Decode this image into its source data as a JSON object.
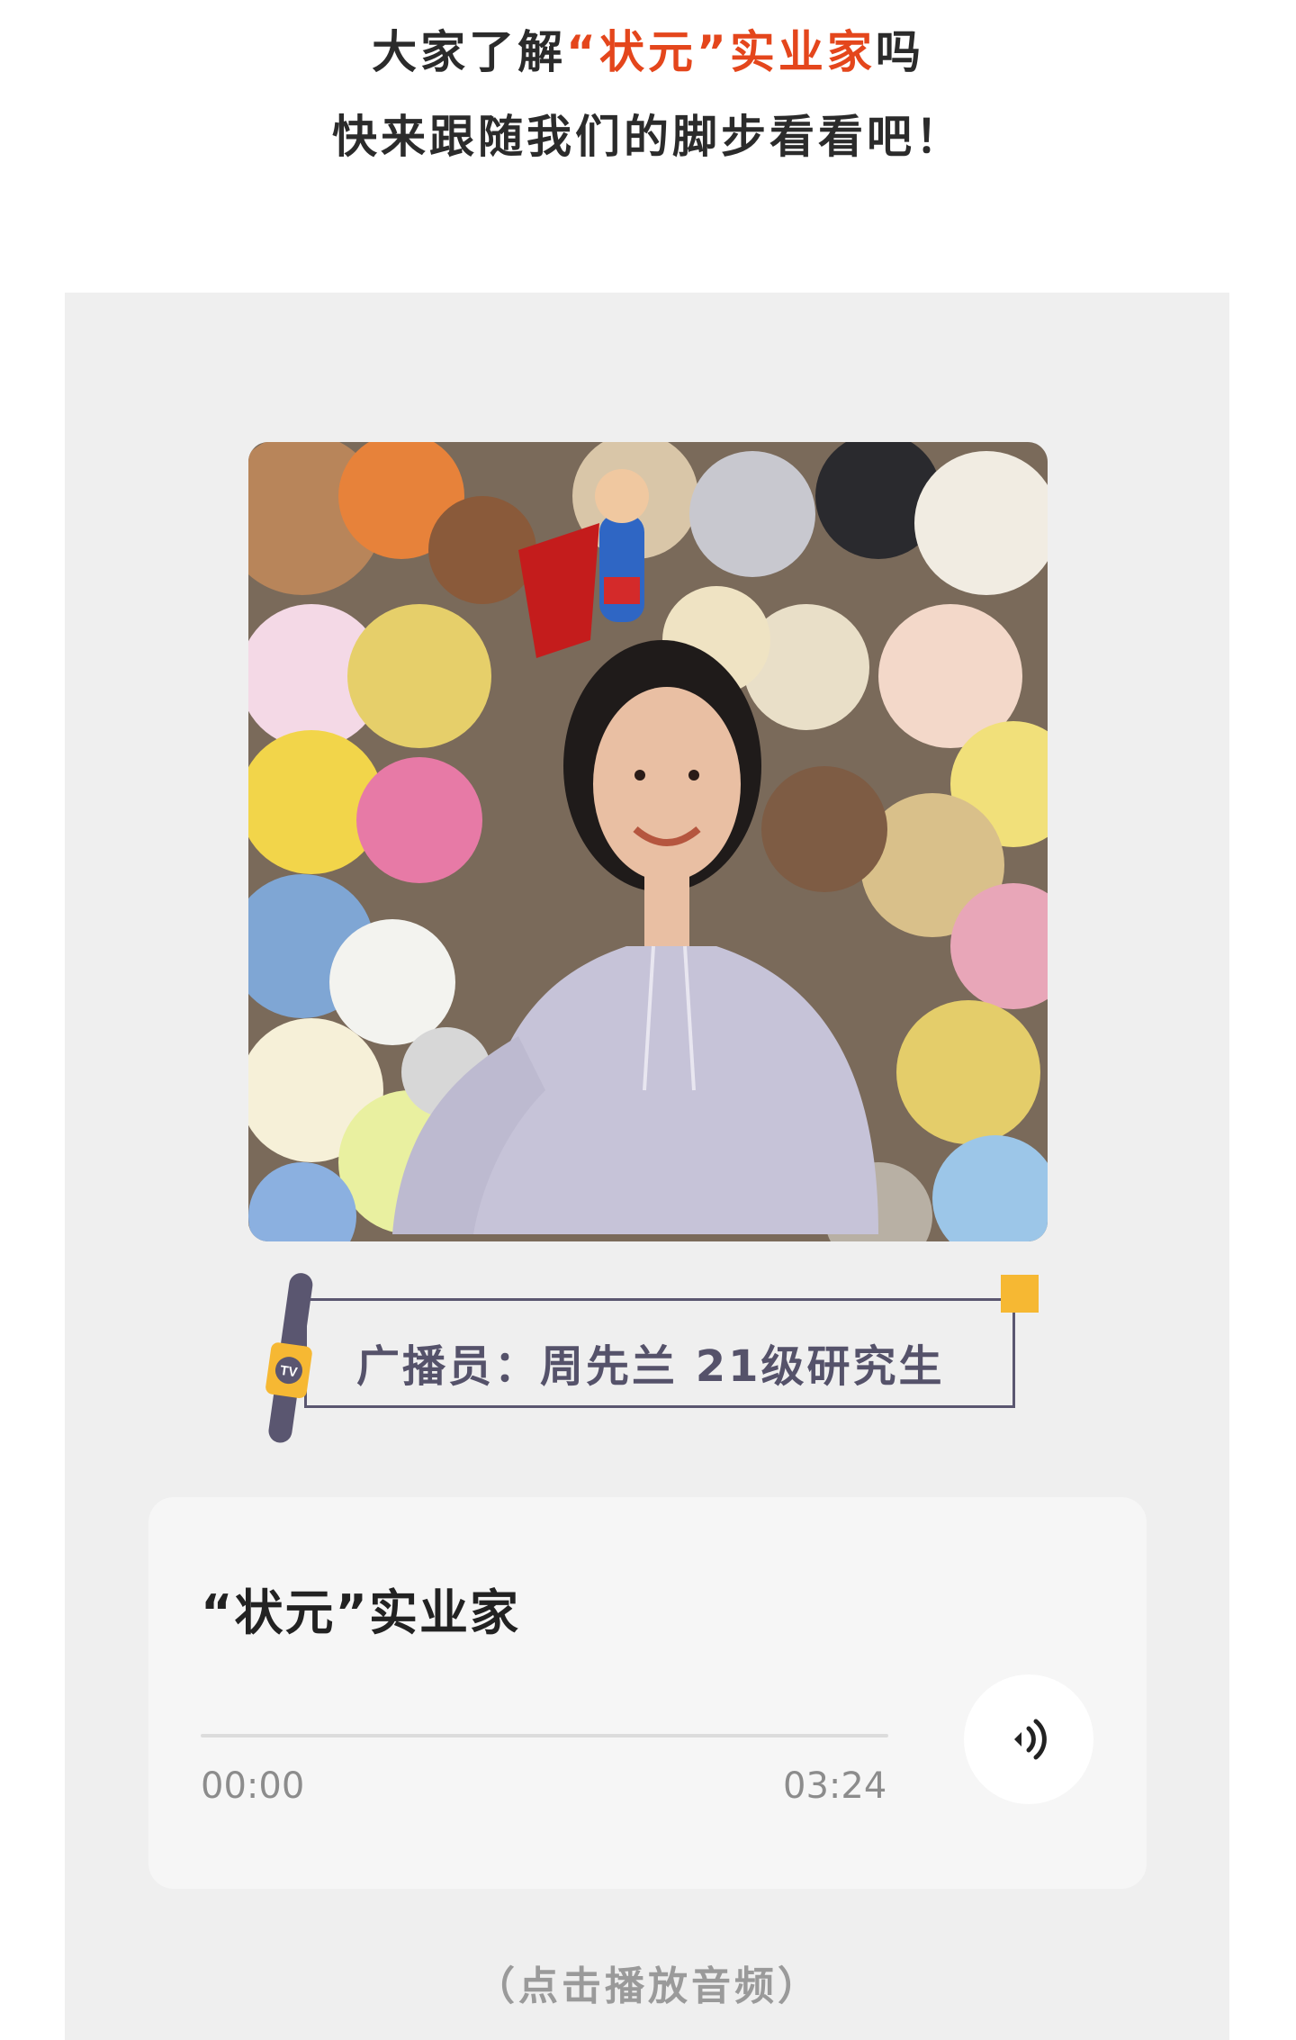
{
  "intro": {
    "line1_before": "大家了解",
    "line1_highlight": "“状元”实业家",
    "line1_after": "吗",
    "line2": "快来跟随我们的脚步看看吧！",
    "highlight_color": "#e4461c"
  },
  "photo": {
    "alt": "广播员周先兰 portrait"
  },
  "announcer": {
    "label": "广播员：周先兰 21级研究生",
    "mic_badge": "TV",
    "accent_color": "#f6b833"
  },
  "audio": {
    "title": "“状元”实业家",
    "current_time": "00:00",
    "total_time": "03:24",
    "progress": 0,
    "play_icon": "speaker-wave-icon"
  },
  "hint": "（点击播放音频）"
}
